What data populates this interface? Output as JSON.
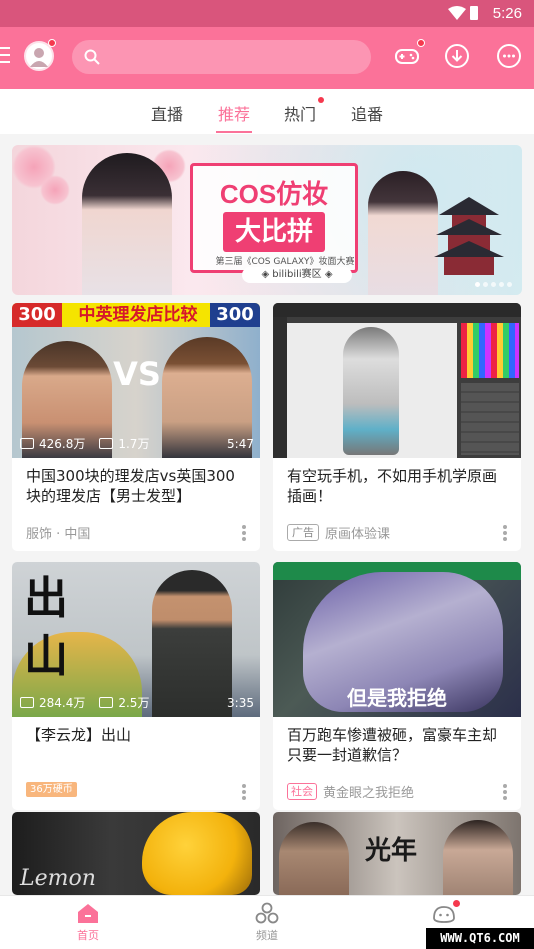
{
  "status_bar": {
    "time": "5:26"
  },
  "app_bar": {
    "search_placeholder": ""
  },
  "tabs": [
    {
      "label": "直播"
    },
    {
      "label": "推荐"
    },
    {
      "label": "热门"
    },
    {
      "label": "追番"
    }
  ],
  "banner": {
    "title_line1": "COS仿妆",
    "title_line2": "大比拼",
    "subtitle": "第三届《COS GALAXY》妆面大赛",
    "brand": "◈ bilibili赛区 ◈"
  },
  "cards": [
    {
      "thumb_top_left": "300",
      "thumb_top_title": "中英理发店比较",
      "thumb_top_right": "300",
      "thumb_vs": "VS",
      "views": "426.8万",
      "danmaku": "1.7万",
      "duration": "5:47",
      "title": "中国300块的理发店vs英国300块的理发店【男士发型】",
      "meta": "服饰 · 中国"
    },
    {
      "title": "有空玩手机，不如用手机学原画插画！",
      "badge": "广告",
      "meta": "原画体验课"
    },
    {
      "thumb_text": "出山",
      "views": "284.4万",
      "danmaku": "2.5万",
      "duration": "3:35",
      "title": "【李云龙】出山",
      "badge": "36万硬币"
    },
    {
      "thumb_text": "但是我拒绝",
      "title": "百万跑车惨遭被砸，富豪车主却只要一封道歉信？",
      "badge": "社会",
      "meta": "黄金眼之我拒绝"
    },
    {
      "thumb_text": "Lemon"
    },
    {
      "thumb_text": "光年"
    }
  ],
  "bottom_nav": [
    {
      "label": "首页"
    },
    {
      "label": "频道"
    },
    {
      "label": ""
    }
  ],
  "watermark": "WWW.QT6.COM"
}
